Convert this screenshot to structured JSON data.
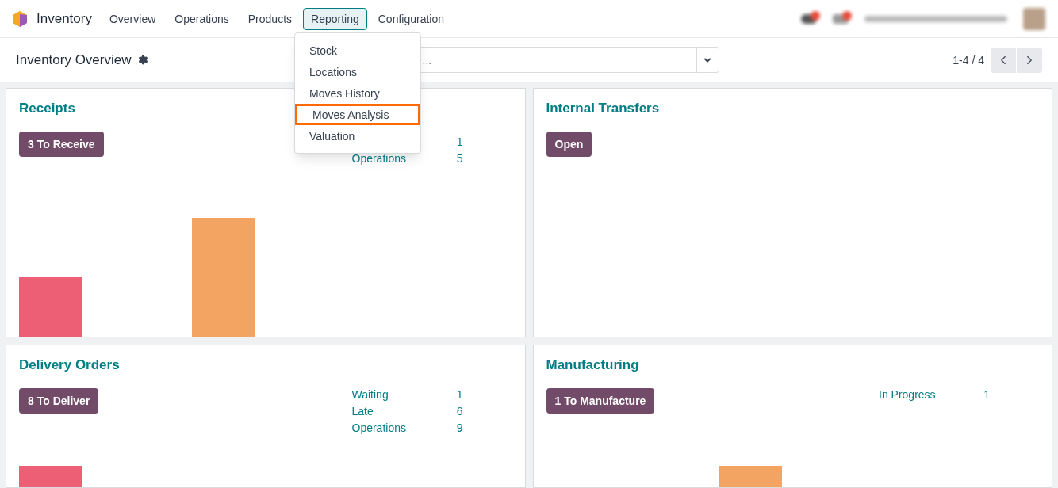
{
  "app": {
    "name": "Inventory"
  },
  "menu": [
    {
      "label": "Overview",
      "selected": false
    },
    {
      "label": "Operations",
      "selected": false
    },
    {
      "label": "Products",
      "selected": false
    },
    {
      "label": "Reporting",
      "selected": true
    },
    {
      "label": "Configuration",
      "selected": false
    }
  ],
  "dropdown": [
    {
      "label": "Stock",
      "selected": false
    },
    {
      "label": "Locations",
      "selected": false
    },
    {
      "label": "Moves History",
      "selected": false
    },
    {
      "label": "Moves Analysis",
      "selected": true
    },
    {
      "label": "Valuation",
      "selected": false
    }
  ],
  "breadcrumb": "Inventory Overview",
  "search": {
    "placeholder": "..."
  },
  "pager": "1-4 / 4",
  "cards": [
    {
      "title": "Receipts",
      "button": "3 To Receive",
      "stats": [
        {
          "value": "1"
        },
        {
          "label": "Operations",
          "value": "5"
        }
      ],
      "graph": true
    },
    {
      "title": "Internal Transfers",
      "button": "Open",
      "graph": false
    },
    {
      "title": "Delivery Orders",
      "button": "8 To Deliver",
      "stats": [
        {
          "label": "Waiting",
          "value": "1"
        },
        {
          "label": "Late",
          "value": "6"
        },
        {
          "label": "Operations",
          "value": "9"
        }
      ],
      "graph": true
    },
    {
      "title": "Manufacturing",
      "button": "1 To Manufacture",
      "stats": [
        {
          "label": "In Progress",
          "value": "1"
        }
      ],
      "graph": true
    }
  ]
}
